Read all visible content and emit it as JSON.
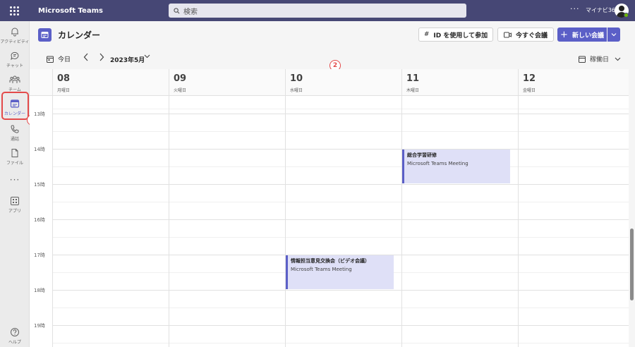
{
  "topbar": {
    "app_title": "Microsoft Teams",
    "search_placeholder": "検索",
    "more": "···",
    "user_name": "マイナビ365"
  },
  "rail": {
    "items": [
      {
        "label": "アクティビティ",
        "icon": "bell-icon"
      },
      {
        "label": "チャット",
        "icon": "chat-icon"
      },
      {
        "label": "チーム",
        "icon": "teams-icon"
      },
      {
        "label": "カレンダー",
        "icon": "calendar-icon",
        "active": true
      },
      {
        "label": "通話",
        "icon": "phone-icon"
      },
      {
        "label": "ファイル",
        "icon": "file-icon"
      },
      {
        "label": "···",
        "icon": "more-icon"
      },
      {
        "label": "アプリ",
        "icon": "apps-icon"
      },
      {
        "label": "ヘルプ",
        "icon": "help-icon"
      }
    ]
  },
  "header": {
    "title": "カレンダー",
    "join_with_id": "ID を使用して参加",
    "meet_now": "今すぐ会議",
    "new_meeting": "新しい会議"
  },
  "nav": {
    "today": "今日",
    "month": "2023年5月",
    "view": "稼働日"
  },
  "annotations": {
    "badge1": "1",
    "badge2": "2"
  },
  "days": [
    {
      "num": "08",
      "weekday": "月曜日"
    },
    {
      "num": "09",
      "weekday": "火曜日"
    },
    {
      "num": "10",
      "weekday": "水曜日"
    },
    {
      "num": "11",
      "weekday": "木曜日"
    },
    {
      "num": "12",
      "weekday": "金曜日"
    }
  ],
  "hours": [
    "13時",
    "14時",
    "15時",
    "16時",
    "17時",
    "18時",
    "19時"
  ],
  "events": [
    {
      "day_index": 3,
      "start": "14:00",
      "end": "15:00",
      "title": "総合学習研修",
      "subtitle": "Microsoft Teams Meeting"
    },
    {
      "day_index": 2,
      "start": "17:00",
      "end": "18:00",
      "title": "情報担当意見交換会（ビデオ会議）",
      "subtitle": "Microsoft Teams Meeting"
    }
  ],
  "colors": {
    "titlebar": "#464775",
    "accent": "#5b5fc7",
    "event_bg": "#dfe0f7",
    "annotation": "#e34a4a"
  }
}
